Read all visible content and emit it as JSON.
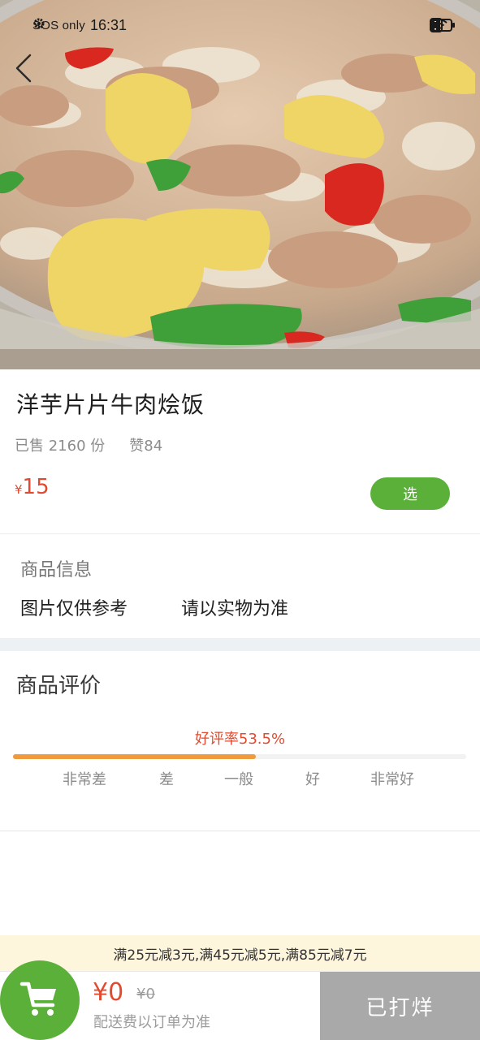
{
  "status_bar": {
    "carrier": "SOS only",
    "time": "16:31"
  },
  "product": {
    "name": "洋芋片片牛肉烩饭",
    "sold": "已售 2160 份",
    "likes": "赞84",
    "currency": "¥",
    "price": "15",
    "select_label": "选"
  },
  "product_info": {
    "label": "商品信息",
    "note1": "图片仅供参考",
    "note2": "请以实物为准"
  },
  "reviews": {
    "title": "商品评价",
    "rate_text": "好评率53.5%",
    "rate_fraction": 0.535,
    "levels": [
      "非常差",
      "差",
      "一般",
      "好",
      "非常好"
    ]
  },
  "promo": {
    "text": "满25元减3元,满45元减5元,满85元减7元"
  },
  "cart": {
    "total": "¥0",
    "original": "¥0",
    "fee_note": "配送费以订单为准",
    "order_button": "已打烊"
  },
  "colors": {
    "accent_green": "#5ab039",
    "price_red": "#e24a2f",
    "rating_orange": "#ef9a3c",
    "promo_bg": "#fdf5dc",
    "closed_grey": "#a9a9a9"
  },
  "icons": [
    "settings-icon",
    "nfc-icon",
    "wifi-icon",
    "alert-icon",
    "battery-icon",
    "back-arrow-icon",
    "cart-icon"
  ]
}
